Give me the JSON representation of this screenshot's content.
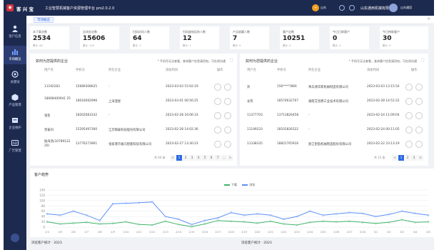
{
  "header": {
    "brand": "客 兴 宝",
    "system_title": "工业智慧机械客户资源管理平台 pro2.0.2.0",
    "company_tag": "山东",
    "company": "山东通用机械有限公司",
    "username": "山东通用"
  },
  "sidebar": {
    "items": [
      {
        "label": "客户信息",
        "icon": "user-icon"
      },
      {
        "label": "市场概览",
        "icon": "bar-chart-icon"
      },
      {
        "label": "关键词",
        "icon": "target-icon"
      },
      {
        "label": "产品管理",
        "icon": "box-icon"
      },
      {
        "label": "企业维护",
        "icon": "building-icon"
      },
      {
        "label": "广告管理",
        "icon": "ad-icon"
      }
    ],
    "active_index": 1
  },
  "tab": {
    "label": "市场概览"
  },
  "stats": [
    {
      "label": "本下载次数",
      "value": "2534",
      "sub": "累计: 60"
    },
    {
      "label": "总浏览次数",
      "value": "15606",
      "sub": "累计: 120"
    },
    {
      "label": "扫码访问人数",
      "value": "64",
      "sub": "累计: 1"
    },
    {
      "label": "扫码留电话的人数",
      "value": "12",
      "sub": "累计: 1"
    },
    {
      "label": "产品收藏人数",
      "value": "7",
      "sub": "累计: 0"
    },
    {
      "label": "客户总数",
      "value": "10251",
      "sub": "累计: 0"
    },
    {
      "label": "今日已联客户",
      "value": "0",
      "sub": "累计: 0"
    },
    {
      "label": "今日待联客户",
      "value": "30",
      "sub": "累计: 0"
    }
  ],
  "left_panel": {
    "title": "如何为您提供的企业",
    "note": "* 手机号无法查看，查询客户信息请用电，可在线沟通",
    "columns": [
      "用户名",
      "手机号",
      "所在企业",
      "添加时间",
      "操作"
    ],
    "rows": [
      {
        "name": "11192283",
        "phone": "15689308625",
        "company": "-",
        "time": "2023-03-03 15:02:19"
      },
      {
        "name": "18068400941 25",
        "phone": "18016092996",
        "company": "上海澄星",
        "time": "2023-03-01 00:56:25"
      },
      {
        "name": "张生",
        "phone": "18202083332",
        "company": "-",
        "time": "2023-02-28 16:06:33"
      },
      {
        "name": "李泰归",
        "phone": "15295497360",
        "company": "江苏锦泰科技股份有限公司",
        "time": "2023-02-28 14:02:36"
      },
      {
        "name": "陆海洛(10789122 20)",
        "phone": "13776273961",
        "company": "张家港市福马智能科技有限公司",
        "time": "2023-02-27 13:30:23"
      }
    ],
    "pager": {
      "total": "共 64 条",
      "pages": [
        "<",
        "1",
        "2",
        "3",
        "4",
        "5",
        "6",
        "7",
        "...",
        ">"
      ],
      "active": "1"
    }
  },
  "right_panel": {
    "title": "如何为您提供的企业",
    "note": "* 手机号无法查看，查询客户信息请用电，可在线沟通",
    "columns": [
      "用户名",
      "手机号",
      "所在企业",
      "添加时间",
      "操作"
    ],
    "rows": [
      {
        "name": "刘",
        "phone": "156****7866",
        "company": "青岛清华新机械制造有限公司",
        "time": "2023-03-03 13:15:54"
      },
      {
        "name": "长笑",
        "phone": "18574632707",
        "company": "湖南艾亮燃工业技术有限公司",
        "time": "2023-02-28 14:51:22"
      },
      {
        "name": "11377703",
        "phone": "13713826458",
        "company": "-",
        "time": "2023-02-24 11:09:04"
      },
      {
        "name": "11149233",
        "phone": "18101826322",
        "company": "-",
        "time": "2023-02-24 00:11:05"
      },
      {
        "name": "11338335",
        "phone": "18821705916",
        "company": "浙江钜航机械制造股份有限公司",
        "time": "2023-02-22 23:13:19"
      }
    ],
    "pager": {
      "total": "共 12 条",
      "pages": [
        "<",
        "1",
        "2",
        "3",
        ">"
      ],
      "active": "1"
    }
  },
  "trend": {
    "title": "客户趋势"
  },
  "bottom": {
    "left_title": "浏览客户统计 · 2023",
    "right_title": "浏览客户统计 · 2023"
  },
  "colors": {
    "blue": "#5b8ff9",
    "green": "#3fb36a",
    "accent": "#2d6ae3"
  },
  "chart_data": {
    "type": "line",
    "title": "客户趋势",
    "x": [
      "2/4",
      "2/5",
      "2/6",
      "2/7",
      "2/8",
      "2/9",
      "2/10",
      "2/11",
      "2/12",
      "2/13",
      "2/14",
      "2/15",
      "2/16",
      "2/17",
      "2/18",
      "2/19",
      "2/20",
      "2/21",
      "2/22",
      "2/23",
      "2/24",
      "2/25",
      "2/26",
      "2/27",
      "2/28",
      "3/1",
      "3/2",
      "3/3",
      "3/4",
      "3/5"
    ],
    "ylim": [
      0,
      140
    ],
    "yticks": [
      0,
      20,
      40,
      60,
      80,
      100,
      120,
      140
    ],
    "series": [
      {
        "name": "下载",
        "color": "#3fb36a",
        "values": [
          20,
          12,
          15,
          18,
          12,
          14,
          20,
          10,
          8,
          22,
          10,
          2,
          12,
          25,
          22,
          20,
          15,
          22,
          12,
          8,
          18,
          22,
          20,
          22,
          18,
          14,
          18,
          28,
          18,
          20
        ]
      },
      {
        "name": "浏览",
        "color": "#5b8ff9",
        "values": [
          50,
          45,
          60,
          45,
          25,
          88,
          90,
          92,
          95,
          40,
          30,
          10,
          25,
          35,
          55,
          45,
          50,
          45,
          30,
          40,
          60,
          45,
          50,
          55,
          52,
          40,
          48,
          60,
          52,
          45
        ]
      }
    ],
    "legend": "top-center",
    "grid": true
  }
}
